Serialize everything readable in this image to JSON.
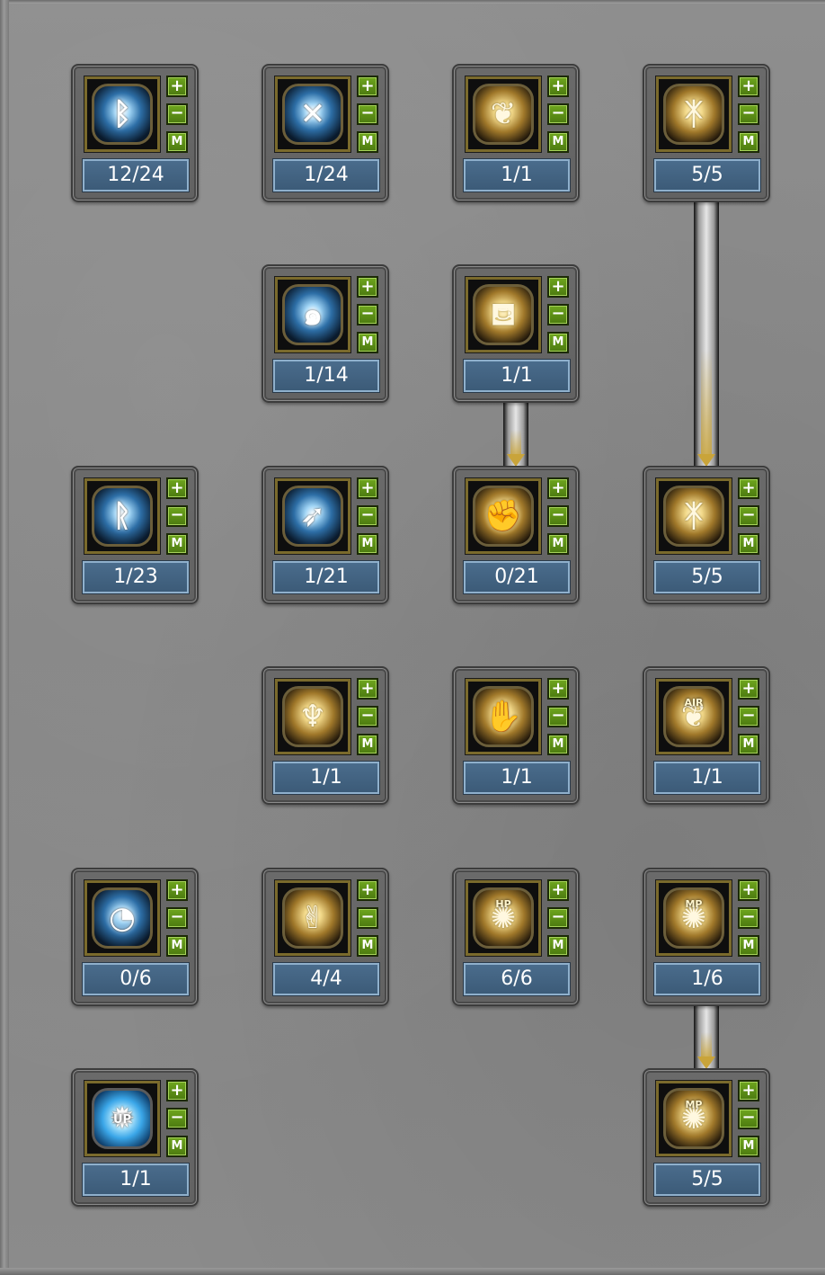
{
  "buttons": {
    "plus": "+",
    "minus": "−",
    "max": "M"
  },
  "skills": [
    {
      "level": "12/24",
      "icon": "lightning-rune-icon",
      "tone": "blue",
      "glyph": "ᛒ"
    },
    {
      "level": "1/24",
      "icon": "crossed-swords-icon",
      "tone": "blue",
      "glyph": "✕"
    },
    {
      "level": "1/1",
      "icon": "wing-crest-icon",
      "tone": "gold",
      "glyph": "❦"
    },
    {
      "level": "5/5",
      "icon": "rune-circle-icon",
      "tone": "gold",
      "glyph": "ᛡ"
    },
    {
      "level": "1/14",
      "icon": "swirl-arm-icon",
      "tone": "blue",
      "glyph": "๑"
    },
    {
      "level": "1/1",
      "icon": "boot-icon",
      "tone": "gold",
      "glyph": "⛾"
    },
    {
      "level": "1/23",
      "icon": "lightning-chain-icon",
      "tone": "blue",
      "glyph": "ᚱ"
    },
    {
      "level": "1/21",
      "icon": "bow-arrow-icon",
      "tone": "blue",
      "glyph": "➶"
    },
    {
      "level": "0/21",
      "icon": "fist-icon",
      "tone": "gold",
      "glyph": "✊"
    },
    {
      "level": "5/5",
      "icon": "rune-circle-icon",
      "tone": "gold",
      "glyph": "ᛡ"
    },
    {
      "level": "1/1",
      "icon": "heroic-figure-icon",
      "tone": "gold",
      "glyph": "♆"
    },
    {
      "level": "1/1",
      "icon": "flexed-arm-icon",
      "tone": "gold",
      "glyph": "✋"
    },
    {
      "level": "1/1",
      "icon": "air-wing-icon",
      "tone": "gold",
      "glyph": "❦",
      "badge": "AIR"
    },
    {
      "level": "0/6",
      "icon": "spiral-eye-icon",
      "tone": "blue",
      "glyph": "◔"
    },
    {
      "level": "4/4",
      "icon": "dancing-figure-icon",
      "tone": "gold",
      "glyph": "✌"
    },
    {
      "level": "6/6",
      "icon": "hp-recovery-icon",
      "tone": "gold",
      "glyph": "✺",
      "badge": "HP"
    },
    {
      "level": "1/6",
      "icon": "mp-recovery-icon",
      "tone": "gold",
      "glyph": "✺",
      "badge": "MP"
    },
    {
      "level": "1/1",
      "icon": "level-up-icon",
      "tone": "cyan",
      "glyph": "✹",
      "badge": "UP"
    },
    {
      "level": "5/5",
      "icon": "mp-boost-icon",
      "tone": "gold",
      "glyph": "✺",
      "badge": "MP"
    }
  ],
  "connectors": [
    {
      "from_skill": "1/1 (boot)",
      "to_skill": "0/21 (fist)"
    },
    {
      "from_skill": "5/5 (rune circle)",
      "to_skill": "5/5 (rune circle)"
    },
    {
      "from_skill": "1/6 (mp recovery)",
      "to_skill": "5/5 (mp boost)"
    }
  ],
  "colors": {
    "background": "#8a8a8a",
    "button_green": "#5c8f16",
    "level_bar": "#42617e",
    "icon_frame_gold": "#7a6a2c",
    "arrow_gold": "#c9a43a"
  }
}
